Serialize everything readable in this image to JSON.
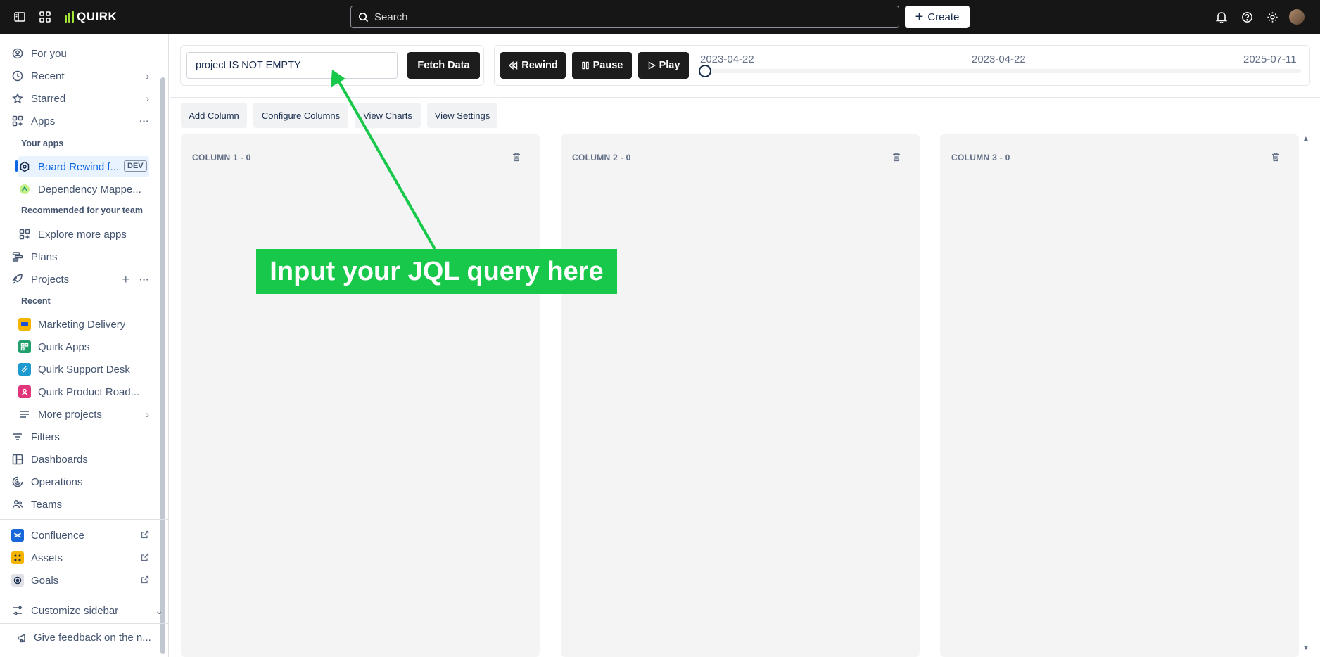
{
  "topbar": {
    "logo_text": "QUIRK",
    "search_placeholder": "Search",
    "create_label": "Create"
  },
  "sidebar": {
    "for_you": "For you",
    "recent": "Recent",
    "starred": "Starred",
    "apps": "Apps",
    "your_apps_heading": "Your apps",
    "app_board_rewind": "Board Rewind f...",
    "dev_badge": "DEV",
    "app_dependency": "Dependency Mappe...",
    "recommended_heading": "Recommended for your team",
    "explore_apps": "Explore more apps",
    "plans": "Plans",
    "projects": "Projects",
    "recent_heading": "Recent",
    "projects_list": [
      {
        "label": "Marketing Delivery",
        "color": "#f5b400"
      },
      {
        "label": "Quirk Apps",
        "color": "#22a06b"
      },
      {
        "label": "Quirk Support Desk",
        "color": "#1d9bd1"
      },
      {
        "label": "Quirk Product Road...",
        "color": "#e2367a"
      }
    ],
    "more_projects": "More projects",
    "filters": "Filters",
    "dashboards": "Dashboards",
    "operations": "Operations",
    "teams": "Teams",
    "confluence": "Confluence",
    "assets": "Assets",
    "goals": "Goals",
    "customize": "Customize sidebar",
    "feedback": "Give feedback on the n..."
  },
  "main": {
    "jql_value": "project IS NOT EMPTY",
    "fetch_label": "Fetch Data",
    "rewind_label": "Rewind",
    "pause_label": "Pause",
    "play_label": "Play",
    "date_start": "2023-04-22",
    "date_current": "2023-04-22",
    "date_end": "2025-07-11",
    "slider_position": 0,
    "tools": [
      "Add Column",
      "Configure Columns",
      "View Charts",
      "View Settings"
    ],
    "columns": [
      {
        "title": "COLUMN 1 - 0"
      },
      {
        "title": "COLUMN 2 - 0"
      },
      {
        "title": "COLUMN 3 - 0"
      }
    ]
  },
  "annotation": {
    "text": "Input your JQL query here",
    "color": "#18c84b"
  }
}
